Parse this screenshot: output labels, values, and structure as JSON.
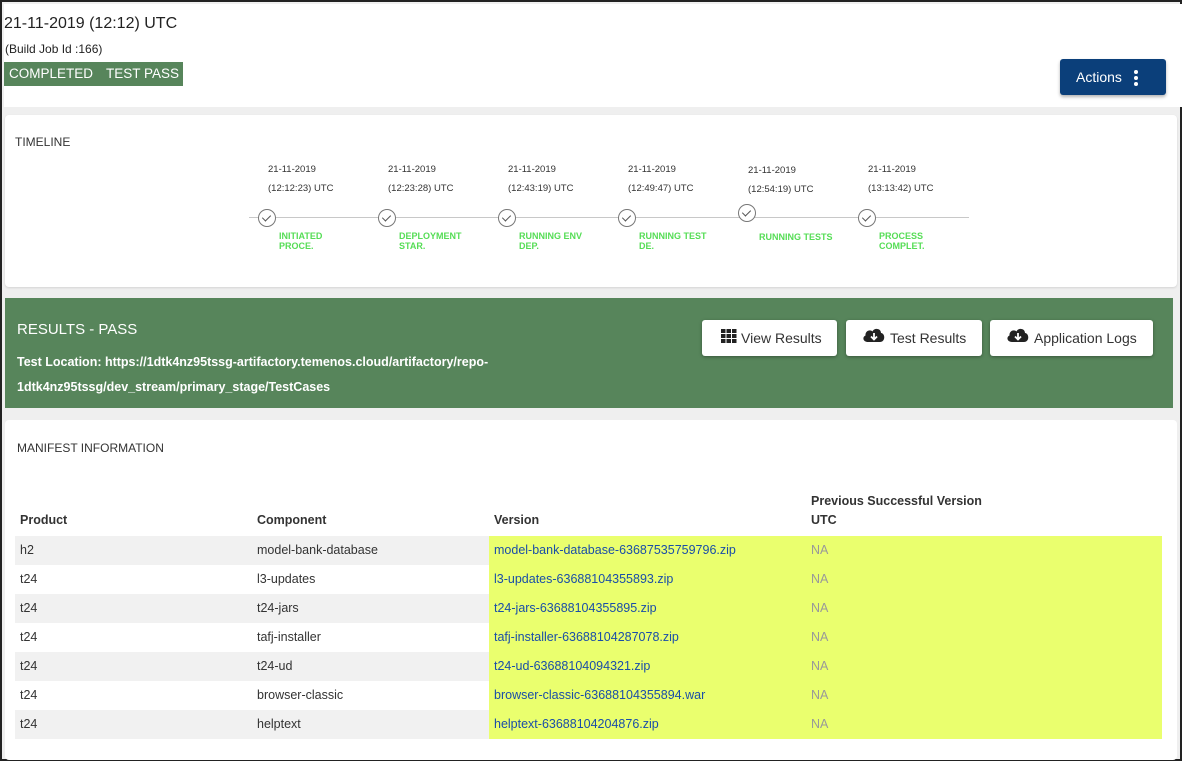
{
  "header": {
    "date_utc": "21-11-2019 (12:12) UTC",
    "build_job": "(Build Job Id :166)",
    "status": [
      "COMPLETED",
      "TEST PASS"
    ],
    "actions_label": "Actions"
  },
  "timeline": {
    "title": "TIMELINE",
    "steps": [
      {
        "date": "21-11-2019",
        "time": "(12:12:23) UTC",
        "label1": "INITIATED",
        "label2": "PROCE."
      },
      {
        "date": "21-11-2019",
        "time": "(12:23:28) UTC",
        "label1": "DEPLOYMENT",
        "label2": "STAR."
      },
      {
        "date": "21-11-2019",
        "time": "(12:43:19) UTC",
        "label1": "RUNNING ENV",
        "label2": "DEP."
      },
      {
        "date": "21-11-2019",
        "time": "(12:49:47) UTC",
        "label1": "RUNNING TEST",
        "label2": "DE."
      },
      {
        "date": "21-11-2019",
        "time": "(12:54:19) UTC",
        "label1": "RUNNING TESTS",
        "label2": ""
      },
      {
        "date": "21-11-2019",
        "time": "(13:13:42) UTC",
        "label1": "PROCESS",
        "label2": "COMPLET."
      }
    ]
  },
  "results": {
    "title": "RESULTS - PASS",
    "location_line1": "Test Location: https://1dtk4nz95tssg-artifactory.temenos.cloud/artifactory/repo-",
    "location_line2": "1dtk4nz95tssg/dev_stream/primary_stage/TestCases",
    "buttons": {
      "view_results": "View Results",
      "test_results": "Test Results",
      "application_logs": "Application Logs"
    }
  },
  "manifest": {
    "title": "MANIFEST INFORMATION",
    "headers": {
      "product": "Product",
      "component": "Component",
      "version": "Version",
      "prev_line1": "Previous Successful Version",
      "prev_line2": "UTC"
    },
    "rows": [
      {
        "product": "h2",
        "component": "model-bank-database",
        "version": "model-bank-database-63687535759796.zip",
        "prev": "NA"
      },
      {
        "product": "t24",
        "component": "l3-updates",
        "version": "l3-updates-63688104355893.zip",
        "prev": "NA"
      },
      {
        "product": "t24",
        "component": "t24-jars",
        "version": "t24-jars-63688104355895.zip",
        "prev": "NA"
      },
      {
        "product": "t24",
        "component": "tafj-installer",
        "version": "tafj-installer-63688104287078.zip",
        "prev": "NA"
      },
      {
        "product": "t24",
        "component": "t24-ud",
        "version": "t24-ud-63688104094321.zip",
        "prev": "NA"
      },
      {
        "product": "t24",
        "component": "browser-classic",
        "version": "browser-classic-63688104355894.war",
        "prev": "NA"
      },
      {
        "product": "t24",
        "component": "helptext",
        "version": "helptext-63688104204876.zip",
        "prev": "NA"
      }
    ]
  },
  "colors": {
    "status_green": "#57855b",
    "actions_blue": "#0b3f7a",
    "timeline_label_green": "#55dd55",
    "version_highlight": "#eaff6e",
    "version_link": "#1a4ea8"
  },
  "icons": {
    "actions": "more-vertical-icon",
    "view_results": "grid-icon",
    "test_results": "cloud-download-icon",
    "application_logs": "cloud-download-icon",
    "timeline_step": "check-circle-icon"
  }
}
